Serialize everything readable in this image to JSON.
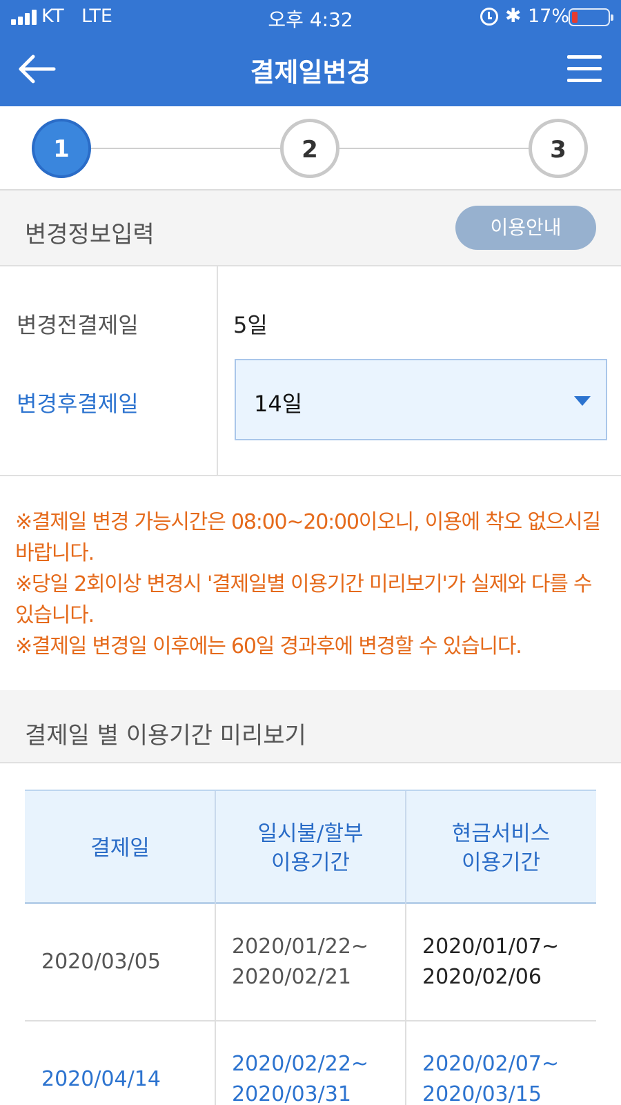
{
  "status_bar": {
    "carrier": "KT",
    "network": "LTE",
    "time": "오후 4:32",
    "battery_percent": "17%",
    "icons": [
      "signal-icon",
      "alarm-icon",
      "bluetooth-icon",
      "battery-icon"
    ]
  },
  "header": {
    "title": "결제일변경",
    "back_icon": "back-arrow-icon",
    "menu_icon": "hamburger-menu-icon"
  },
  "stepper": {
    "steps": [
      {
        "label": "1",
        "active": true
      },
      {
        "label": "2",
        "active": false
      },
      {
        "label": "3",
        "active": false
      }
    ]
  },
  "section_input": {
    "title": "변경정보입력",
    "guide_button": "이용안내"
  },
  "form": {
    "before_label": "변경전결제일",
    "before_value": "5일",
    "after_label": "변경후결제일",
    "after_value": "14일"
  },
  "notices": [
    "※결제일 변경 가능시간은 08:00~20:00이오니, 이용에 착오 없으시길 바랍니다.",
    "※당일 2회이상 변경시 '결제일별 이용기간 미리보기'가 실제와 다를 수 있습니다.",
    "※결제일 변경일 이후에는 60일 경과후에 변경할 수 있습니다."
  ],
  "section_preview": {
    "title": "결제일 별 이용기간 미리보기"
  },
  "table": {
    "headers": {
      "payment_date": "결제일",
      "installment_line1": "일시불/할부",
      "installment_line2": "이용기간",
      "cash_line1": "현금서비스",
      "cash_line2": "이용기간"
    },
    "rows": [
      {
        "date": "2020/03/05",
        "installment_start": "2020/01/22~",
        "installment_end": "2020/02/21",
        "cash_start": "2020/01/07~",
        "cash_end": "2020/02/06"
      },
      {
        "date": "2020/04/14",
        "installment_start": "2020/02/22~",
        "installment_end": "2020/03/31",
        "cash_start": "2020/02/07~",
        "cash_end": "2020/03/15"
      }
    ]
  },
  "colors": {
    "header_blue": "#3476d3",
    "accent_blue": "#2c73cf",
    "notice_orange": "#e56a1b",
    "button_gray_blue": "#97b1cf",
    "battery_red": "#e53b2f"
  }
}
